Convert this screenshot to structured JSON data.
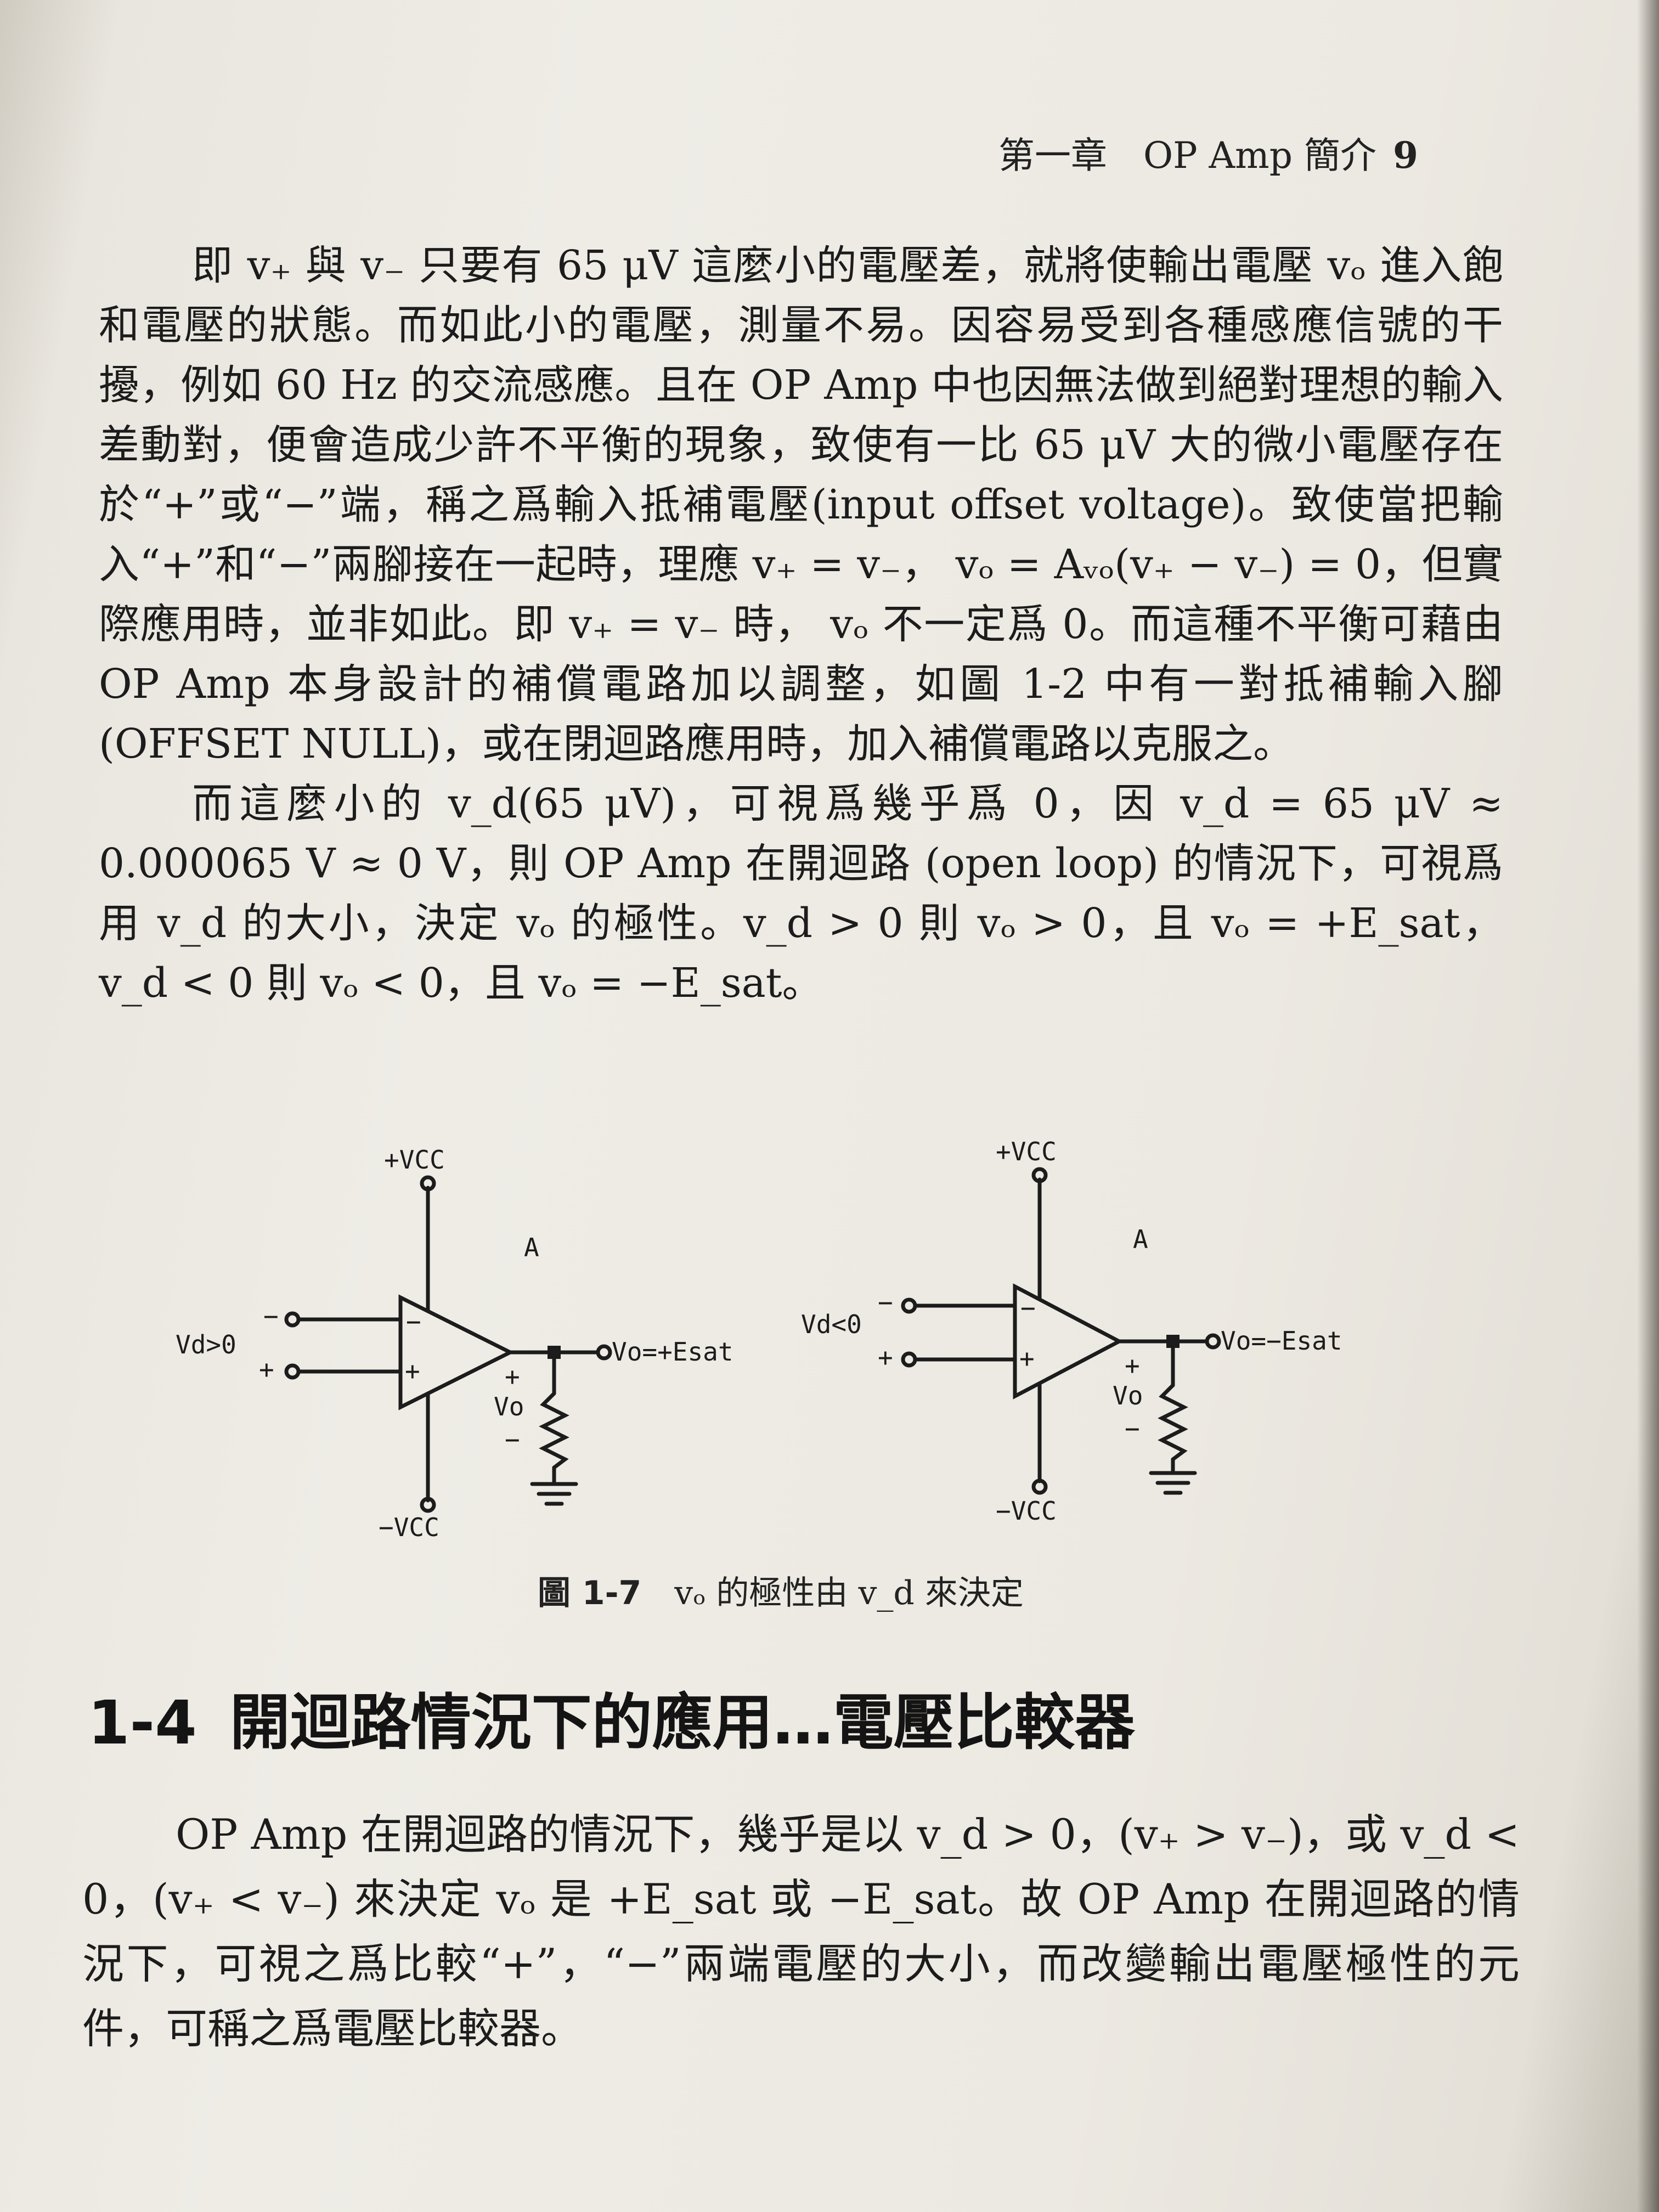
{
  "header": {
    "chapter": "第一章　OP Amp 簡介",
    "page_number": "9"
  },
  "paragraphs": [
    "即 v₊ 與 v₋ 只要有 65 μV 這麼小的電壓差，就將使輸出電壓 vₒ 進入飽和電壓的狀態。而如此小的電壓，測量不易。因容易受到各種感應信號的干擾，例如 60 Hz 的交流感應。且在 OP Amp 中也因無法做到絕對理想的輸入差動對，便會造成少許不平衡的現象，致使有一比 65 μV 大的微小電壓存在於“+”或“−”端，稱之爲輸入抵補電壓(input offset voltage)。致使當把輸入“+”和“−”兩腳接在一起時，理應 v₊ = v₋， vₒ = Aᵥₒ(v₊ − v₋) = 0，但實際應用時，並非如此。即 v₊ = v₋ 時， vₒ 不一定爲 0。而這種不平衡可藉由 OP Amp 本身設計的補償電路加以調整，如圖 1-2 中有一對抵補輸入腳(OFFSET NULL)，或在閉迴路應用時，加入補償電路以克服之。",
    "而這麼小的 v_d(65 μV)，可視爲幾乎爲 0，因 v_d = 65 μV ≈ 0.000065 V ≈ 0 V，則 OP Amp 在開迴路 (open loop) 的情況下，可視爲用 v_d 的大小，決定 vₒ 的極性。v_d > 0 則 vₒ > 0，且 vₒ = +E_sat， v_d < 0 則 vₒ < 0，且 vₒ = −E_sat。"
  ],
  "figure": {
    "left": {
      "vcc_top": "+VCC",
      "vcc_bottom": "−VCC",
      "node": "A",
      "input": "Vd>0",
      "minus": "−",
      "plus": "+",
      "out_plus": "+",
      "out_minus": "−",
      "vo": "Vo",
      "output": "Vo=+Esat"
    },
    "right": {
      "vcc_top": "+VCC",
      "vcc_bottom": "−VCC",
      "node": "A",
      "input": "Vd<0",
      "minus": "−",
      "plus": "+",
      "out_plus": "+",
      "out_minus": "−",
      "vo": "Vo",
      "output": "Vo=−Esat"
    },
    "caption_label": "圖 1-7",
    "caption_text": "vₒ 的極性由 v_d 來決定"
  },
  "section": {
    "number": "1-4",
    "title": "開迴路情況下的應用…電壓比較器",
    "body": "OP Amp 在開迴路的情況下，幾乎是以 v_d > 0，(v₊ > v₋)，或 v_d < 0，(v₊ < v₋) 來決定 vₒ 是 +E_sat 或 −E_sat。故 OP Amp 在開迴路的情況下，可視之爲比較“+”，“−”兩端電壓的大小，而改變輸出電壓極性的元件，可稱之爲電壓比較器。"
  }
}
